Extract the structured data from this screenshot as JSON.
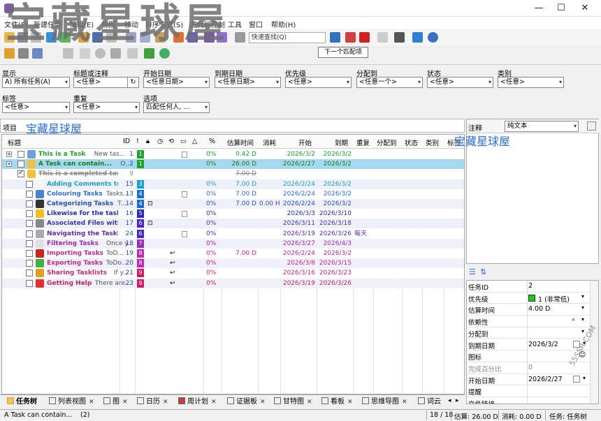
{
  "watermark": {
    "big": "宝藏星球屋",
    "small_project": "宝藏星球屋",
    "small_comment": "宝藏星球屋",
    "corner": "55SSR.COM"
  },
  "menu": [
    "文件(F)",
    "新建任务",
    "编辑(E)",
    "视图",
    "移动",
    "排序方式(S)",
    "源代码控制",
    "工具",
    "窗口",
    "帮助(H)"
  ],
  "toolbar": {
    "quickfind_placeholder": "快速查找(Q)",
    "tooltip": "下一个匹配项"
  },
  "filters": {
    "show": {
      "label": "显示",
      "value": "A)  所有任务(A)"
    },
    "title": {
      "label": "标题或注释",
      "value": "<任意>"
    },
    "start": {
      "label": "开始日期",
      "value": "<任意日期>"
    },
    "due": {
      "label": "到期日期",
      "value": "<任意日期>"
    },
    "priority": {
      "label": "优先级",
      "value": "<任意>"
    },
    "assigned": {
      "label": "分配到",
      "value": "<任意一个>"
    },
    "status": {
      "label": "状态",
      "value": "<任意>"
    },
    "category": {
      "label": "类别",
      "value": "<任意>"
    },
    "tags": {
      "label": "标签",
      "value": "<任意>"
    },
    "recur": {
      "label": "重复",
      "value": "<任意>"
    },
    "options": {
      "label": "选项",
      "value": "匹配任何人, ..."
    }
  },
  "project": {
    "label": "项目"
  },
  "columns": {
    "title": "标题",
    "id": "ID",
    "pct": "%",
    "est": "估算时间",
    "spent": "消耗",
    "start": "开始",
    "due": "到期",
    "recur": "重复",
    "alloc": "分配到",
    "status": "状态",
    "cat": "类别",
    "tag": "标签"
  },
  "tasks": [
    {
      "title": "This is a Task",
      "note": "New tas...",
      "id": "1",
      "pri": "1",
      "pricolor": "#1fa12a",
      "color": "#1fa12a",
      "pct": "0%",
      "est": "0.42 D",
      "spent": "",
      "start": "2026/3/2",
      "due": "2026/3/2",
      "recur": "",
      "icon": "#6aa0e0",
      "strike": false
    },
    {
      "title": "A Task can contain...",
      "note": "O...",
      "id": "2",
      "pri": "1",
      "pricolor": "#1fa12a",
      "color": "#1a7a1a",
      "pct": "0%",
      "est": "26.00 D",
      "spent": "",
      "start": "2026/2/27",
      "due": "2026/3/2",
      "recur": "",
      "icon": "#f0c040",
      "strike": false
    },
    {
      "title": "This is a completed task",
      "note": "",
      "id": "9",
      "pri": "",
      "pricolor": "",
      "color": "#888888",
      "pct": "",
      "est": "7.00 D",
      "spent": "",
      "start": "",
      "due": "",
      "recur": "",
      "icon": "#f0c040",
      "strike": true
    },
    {
      "title": "Adding Comments to T...",
      "note": "",
      "id": "15",
      "pri": "3",
      "pricolor": "#1aa0c8",
      "color": "#1aa0c8",
      "pct": "0%",
      "est": "7.00 D",
      "spent": "",
      "start": "2026/2/24",
      "due": "2026/3/2",
      "recur": "",
      "icon": "#f5f5f5",
      "strike": false
    },
    {
      "title": "Colouring Tasks",
      "note": "Tasks...",
      "id": "13",
      "pri": "4",
      "pricolor": "#1a70c8",
      "color": "#2a6fd6",
      "pct": "0%",
      "est": "7.00 D",
      "spent": "",
      "start": "2026/2/24",
      "due": "2026/3/2",
      "recur": "",
      "icon": "#4a80d0",
      "strike": false
    },
    {
      "title": "Categorizing Tasks",
      "note": "T...",
      "id": "14",
      "pri": "4",
      "pricolor": "#1a70c8",
      "color": "#2a55b0",
      "pct": "0%",
      "est": "7.00 D",
      "spent": "0.00 H",
      "start": "2026/2/24",
      "due": "2026/3/2",
      "recur": "",
      "icon": "#333333",
      "strike": false
    },
    {
      "title": "Likewise for the task's ...",
      "note": "",
      "id": "16",
      "pri": "5",
      "pricolor": "#2a2ab8",
      "color": "#2a2ab8",
      "pct": "0%",
      "est": "",
      "spent": "",
      "start": "2026/3/3",
      "due": "2026/3/10",
      "recur": "",
      "icon": "#f0c020",
      "strike": false
    },
    {
      "title": "Associated Files with T...",
      "note": "",
      "id": "17",
      "pri": "6",
      "pricolor": "#4a2ab8",
      "color": "#3a3aa0",
      "pct": "0%",
      "est": "",
      "spent": "",
      "start": "2026/3/11",
      "due": "2026/3/18",
      "recur": "",
      "icon": "#888888",
      "strike": false
    },
    {
      "title": "Navigating the Tasklist",
      "note": "",
      "id": "24",
      "pri": "6",
      "pricolor": "#4a2ab8",
      "color": "#5a2ab0",
      "pct": "0%",
      "est": "",
      "spent": "",
      "start": "2026/3/19",
      "due": "2026/3/26",
      "recur": "每天",
      "icon": "#aaaaaa",
      "strike": false
    },
    {
      "title": "Filtering Tasks",
      "note": "Once y...",
      "id": "18",
      "pri": "7",
      "pricolor": "#9a2ab8",
      "color": "#9a2ab8",
      "pct": "0%",
      "est": "",
      "spent": "",
      "start": "2026/3/27",
      "due": "2026/4/3",
      "recur": "",
      "icon": "#e0e0e0",
      "strike": false
    },
    {
      "title": "Importing Tasks",
      "note": "ToD...",
      "id": "19",
      "pri": "8",
      "pricolor": "#c02ab0",
      "color": "#c02a90",
      "pct": "0%",
      "est": "7.00 D",
      "spent": "",
      "start": "2026/2/24",
      "due": "2026/3/2",
      "recur": "",
      "icon": "#d02020",
      "strike": false
    },
    {
      "title": "Exporting Tasks",
      "note": "ToDo...",
      "id": "20",
      "pri": "8",
      "pricolor": "#c02ab0",
      "color": "#c02a90",
      "pct": "0%",
      "est": "",
      "spent": "",
      "start": "2026/3/8",
      "due": "2026/3/15",
      "recur": "",
      "icon": "#40b040",
      "strike": false
    },
    {
      "title": "Sharing Tasklists",
      "note": "If y...",
      "id": "21",
      "pri": "9",
      "pricolor": "#d01a6a",
      "color": "#c02a70",
      "pct": "0%",
      "est": "",
      "spent": "",
      "start": "2026/3/16",
      "due": "2026/3/23",
      "recur": "",
      "icon": "#e0a020",
      "strike": false
    },
    {
      "title": "Getting Help",
      "note": "There are...",
      "id": "23",
      "pri": "9",
      "pricolor": "#d01a6a",
      "color": "#c02a50",
      "pct": "0%",
      "est": "",
      "spent": "",
      "start": "2026/3/19",
      "due": "2026/3/26",
      "recur": "",
      "icon": "#e03030",
      "strike": false
    }
  ],
  "comments": {
    "label": "注释",
    "format": "纯文本"
  },
  "attributes": [
    {
      "k": "任务ID",
      "v": "2"
    },
    {
      "k": "优先级",
      "v": "1 (非常低)"
    },
    {
      "k": "估算时间",
      "v": "4.00 D"
    },
    {
      "k": "依赖性",
      "v": ""
    },
    {
      "k": "分配到",
      "v": ""
    },
    {
      "k": "到期日期",
      "v": "2026/3/2"
    },
    {
      "k": "图标",
      "v": ""
    },
    {
      "k": "完成百分比",
      "v": "0"
    },
    {
      "k": "开始日期",
      "v": "2026/2/27"
    },
    {
      "k": "提醒",
      "v": ""
    },
    {
      "k": "文件链接",
      "v": ""
    }
  ],
  "tabs": [
    "任务树",
    "列表视图",
    "图",
    "日历",
    "周计划",
    "证据板",
    "甘特图",
    "看板",
    "思维导图",
    "词云"
  ],
  "status": {
    "sel": "A Task can contain...",
    "selcount": "(2)",
    "count": "18 / 18",
    "est": "估算: 26.00 D",
    "spent": "消耗: 0.00 D",
    "view": "任务: 任务树"
  }
}
